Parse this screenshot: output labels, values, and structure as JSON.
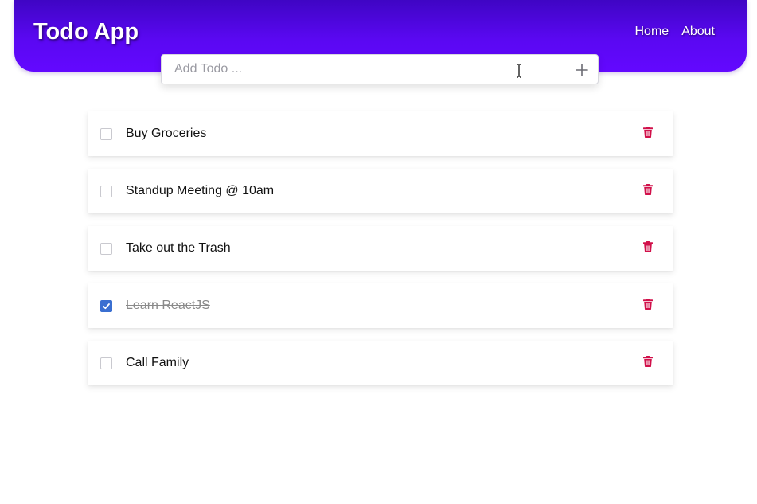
{
  "header": {
    "title": "Todo App",
    "nav": [
      "Home",
      "About"
    ]
  },
  "add_todo": {
    "placeholder": "Add Todo ...",
    "value": "",
    "add_icon": "plus-icon"
  },
  "todos": [
    {
      "text": "Buy Groceries",
      "completed": false
    },
    {
      "text": "Standup Meeting @ 10am",
      "completed": false
    },
    {
      "text": "Take out the Trash",
      "completed": false
    },
    {
      "text": "Learn ReactJS",
      "completed": true
    },
    {
      "text": "Call Family",
      "completed": false
    }
  ],
  "icons": {
    "delete": "trash-icon",
    "check": "check-icon"
  },
  "colors": {
    "header_gradient_start": "#3f05c4",
    "header_gradient_end": "#6308ff",
    "delete_icon": "#d1104a",
    "checkbox_checked": "#3a6fd1"
  }
}
